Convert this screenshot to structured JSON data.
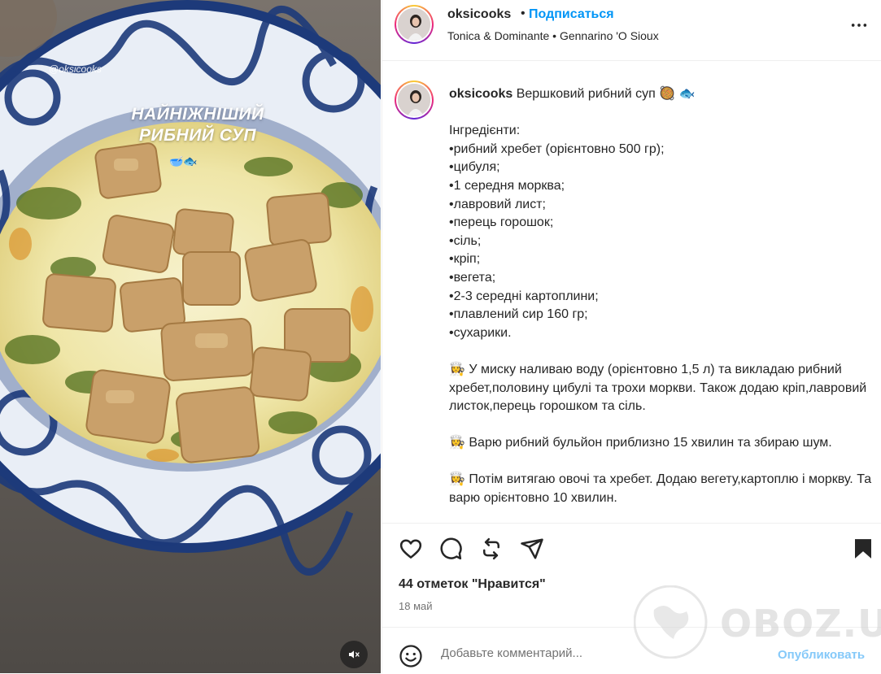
{
  "media": {
    "watermark_handle": "@oksicooks",
    "overlay_title_line1": "НАЙНІЖНІШИЙ",
    "overlay_title_line2": "РИБНИЙ СУП",
    "overlay_emoji": "🥣🐟",
    "mute_icon": "speaker-muted-icon"
  },
  "header": {
    "username": "oksicooks",
    "separator": "•",
    "follow_label": "Подписаться",
    "music": "Tonica & Dominante • Gennarino 'O Sioux",
    "more_icon": "more-options-icon"
  },
  "caption": {
    "username": "oksicooks",
    "text": " Вершковий рибний суп 🥘 🐟\n\nІнгредієнти:\n•рибний хребет (орієнтовно 500 гр);\n•цибуля;\n•1 середня морква;\n•лавровий лист;\n•перець горошок;\n•сіль;\n•кріп;\n•вегета;\n•2-3 середні картоплини;\n•плавлений сир 160 гр;\n•сухарики.\n\n👩‍🍳 У миску наливаю воду (орієнтовно 1,5 л) та викладаю рибний хребет,половину цибулі та трохи моркви. Також додаю кріп,лавровий листок,перець горошком та сіль.\n\n👩‍🍳 Варю рибний бульйон приблизно 15 хвилин та збираю шум.\n\n👩‍🍳 Потім витягаю овочі та хребет. Додаю вегету,картоплю і моркву. Та варю орієнтовно 10 хвилин."
  },
  "actions": {
    "like_icon": "heart-icon",
    "comment_icon": "comment-icon",
    "repost_icon": "repost-icon",
    "share_icon": "send-icon",
    "save_icon": "bookmark-icon"
  },
  "likes_text": "44 отметок \"Нравится\"",
  "date_text": "18 май",
  "comment": {
    "placeholder": "Добавьте комментарий...",
    "publish_label": "Опубликовать",
    "emoji_icon": "smiley-icon"
  },
  "watermark": {
    "text": "OBOZ.UA"
  },
  "colors": {
    "accent": "#0095f6",
    "publish_disabled": "#85c9f9",
    "text": "#262626",
    "secondary": "#737373"
  }
}
